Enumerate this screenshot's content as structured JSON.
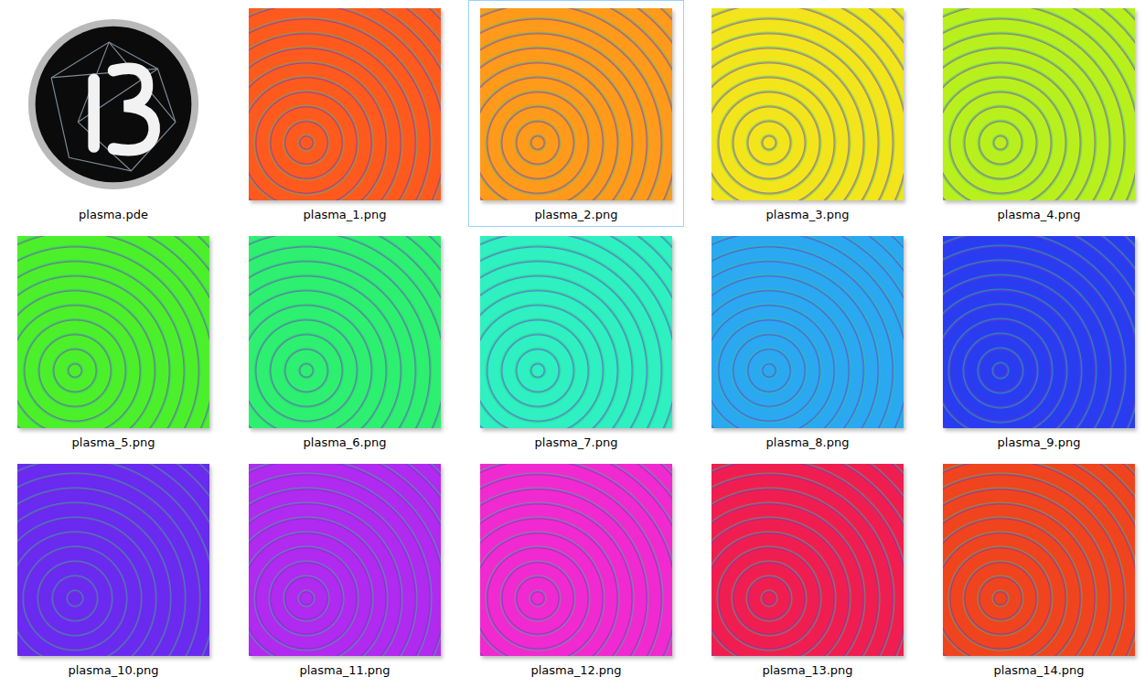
{
  "files": [
    {
      "name": "plasma.pde",
      "kind": "sketch",
      "selected": false
    },
    {
      "name": "plasma_1.png",
      "kind": "image",
      "selected": false,
      "color": "#ff5a1e"
    },
    {
      "name": "plasma_2.png",
      "kind": "image",
      "selected": true,
      "color": "#ff9a1a"
    },
    {
      "name": "plasma_3.png",
      "kind": "image",
      "selected": false,
      "color": "#f2e51c"
    },
    {
      "name": "plasma_4.png",
      "kind": "image",
      "selected": false,
      "color": "#b8f01e"
    },
    {
      "name": "plasma_5.png",
      "kind": "image",
      "selected": false,
      "color": "#4cf02a"
    },
    {
      "name": "plasma_6.png",
      "kind": "image",
      "selected": false,
      "color": "#2ef070"
    },
    {
      "name": "plasma_7.png",
      "kind": "image",
      "selected": false,
      "color": "#2ef0c0"
    },
    {
      "name": "plasma_8.png",
      "kind": "image",
      "selected": false,
      "color": "#2aa8f0"
    },
    {
      "name": "plasma_9.png",
      "kind": "image",
      "selected": false,
      "color": "#2a3cf0"
    },
    {
      "name": "plasma_10.png",
      "kind": "image",
      "selected": false,
      "color": "#6a2af0"
    },
    {
      "name": "plasma_11.png",
      "kind": "image",
      "selected": false,
      "color": "#b02af0"
    },
    {
      "name": "plasma_12.png",
      "kind": "image",
      "selected": false,
      "color": "#f02ad0"
    },
    {
      "name": "plasma_13.png",
      "kind": "image",
      "selected": false,
      "color": "#f01e50"
    },
    {
      "name": "plasma_14.png",
      "kind": "image",
      "selected": false,
      "color": "#f0441e"
    }
  ]
}
